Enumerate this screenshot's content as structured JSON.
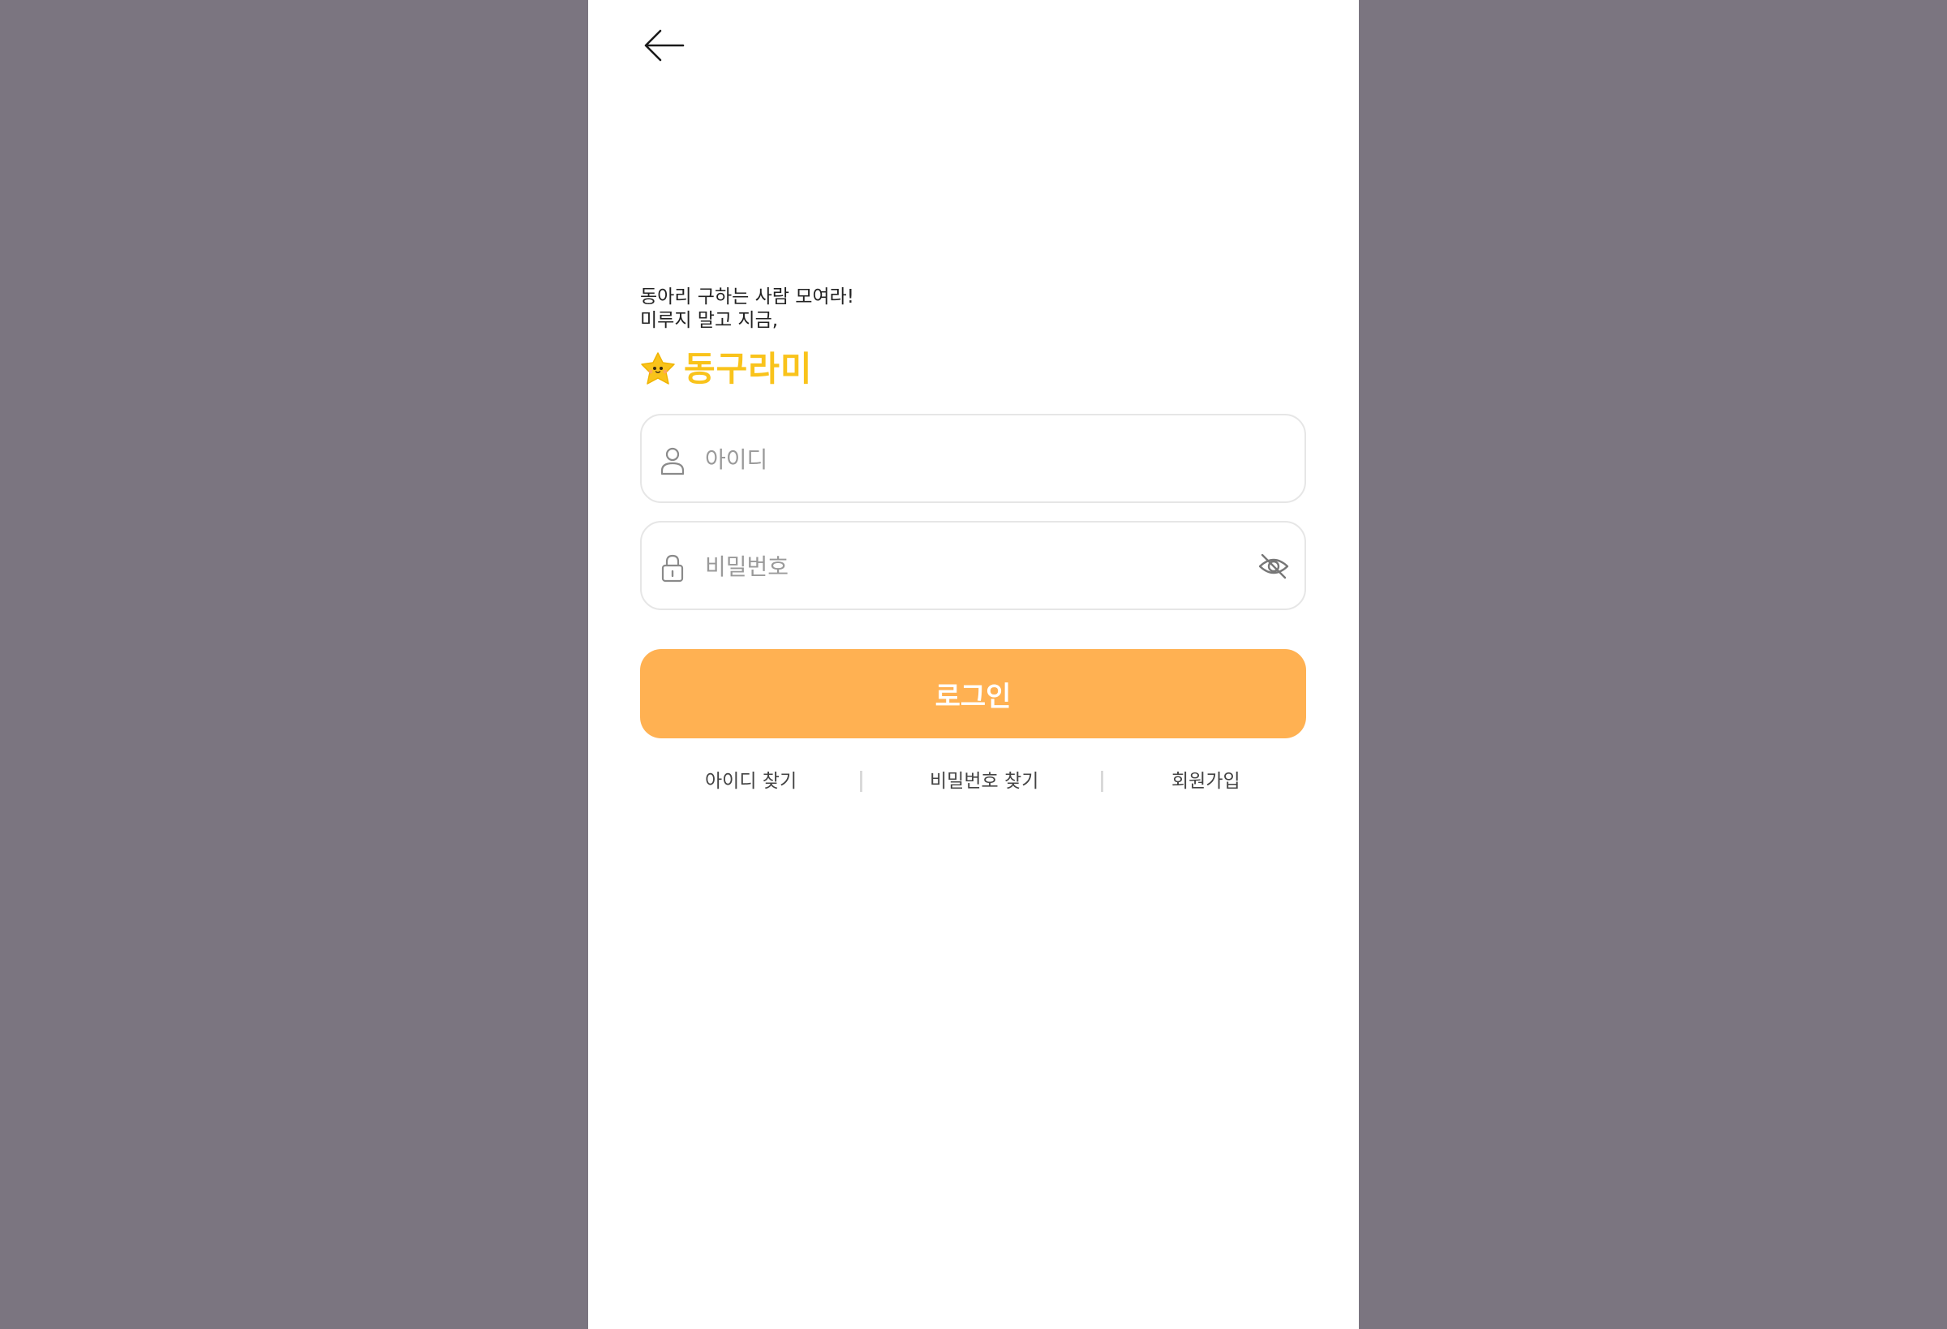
{
  "header": {
    "back_icon": "arrow-left-icon"
  },
  "intro": {
    "line1": "동아리 구하는 사람 모여라!",
    "line2": "미루지 말고 지금,"
  },
  "brand": {
    "name": "동구라미",
    "mascot_icon": "star-mascot-icon",
    "color": "#f9c31b"
  },
  "form": {
    "id_field": {
      "placeholder": "아이디",
      "value": "",
      "icon": "user-icon"
    },
    "password_field": {
      "placeholder": "비밀번호",
      "value": "",
      "icon": "lock-icon",
      "toggle_icon": "eye-off-icon"
    },
    "login_label": "로그인",
    "login_color": "#ffb152"
  },
  "links": {
    "find_id": "아이디 찾기",
    "find_password": "비밀번호 찾기",
    "signup": "회원가입"
  },
  "colors": {
    "backdrop": "#7b7580",
    "screen": "#ffffff"
  }
}
